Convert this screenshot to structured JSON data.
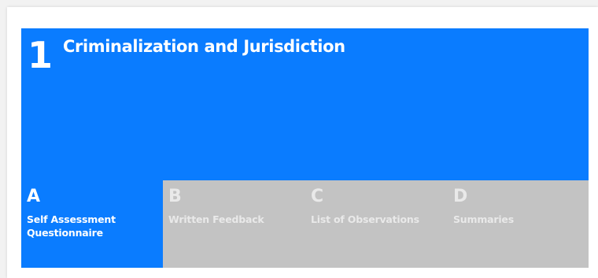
{
  "colors": {
    "accent": "#0a7cff",
    "inactive_tab_bg": "#c3c3c3",
    "inactive_text": "#e9e9e9",
    "active_text": "#ffffff"
  },
  "section": {
    "number": "1",
    "title": "Criminalization and Jurisdiction"
  },
  "tabs": [
    {
      "letter": "A",
      "label_line1": "Self Assessment",
      "label_line2": "Questionnaire",
      "active": true
    },
    {
      "letter": "B",
      "label_line1": "Written Feedback",
      "label_line2": "",
      "active": false
    },
    {
      "letter": "C",
      "label_line1": "List of Observations",
      "label_line2": "",
      "active": false
    },
    {
      "letter": "D",
      "label_line1": "Summaries",
      "label_line2": "",
      "active": false
    }
  ]
}
